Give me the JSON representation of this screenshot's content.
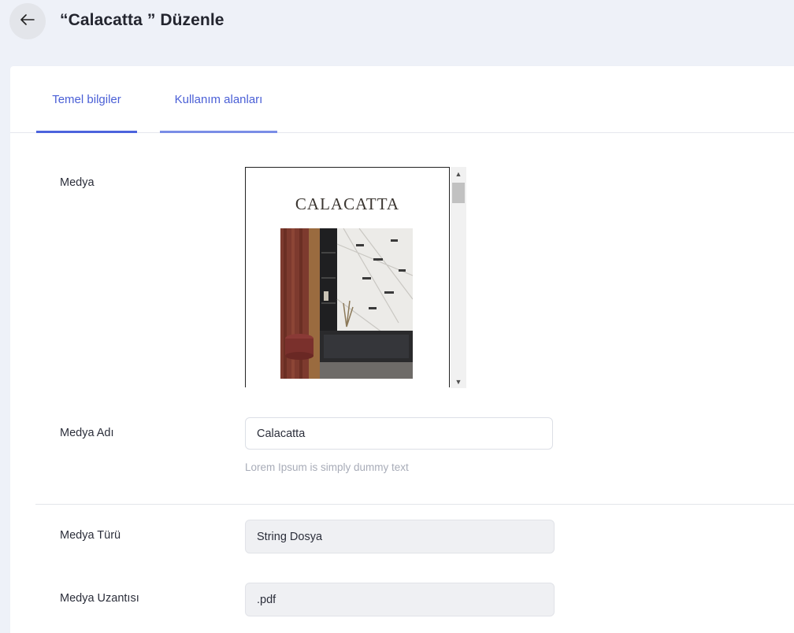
{
  "header": {
    "title": "“Calacatta ” Düzenle"
  },
  "tabs": [
    {
      "label": "Temel bilgiler"
    },
    {
      "label": "Kullanım alanları"
    }
  ],
  "form": {
    "media": {
      "label": "Medya",
      "preview_title": "CALACATTA"
    },
    "media_name": {
      "label": "Medya Adı",
      "value": "Calacatta",
      "hint": "Lorem Ipsum is simply dummy text"
    },
    "media_type": {
      "label": "Medya Türü",
      "value": "String Dosya"
    },
    "media_extension": {
      "label": "Medya Uzantısı",
      "value": ".pdf"
    }
  },
  "colors": {
    "accent": "#4c63dd",
    "background": "#eef1f8",
    "readonly_bg": "#eff0f3"
  },
  "icons": {
    "back": "arrow-left-icon",
    "scroll_up": "triangle-up-icon",
    "scroll_down": "triangle-down-icon"
  }
}
